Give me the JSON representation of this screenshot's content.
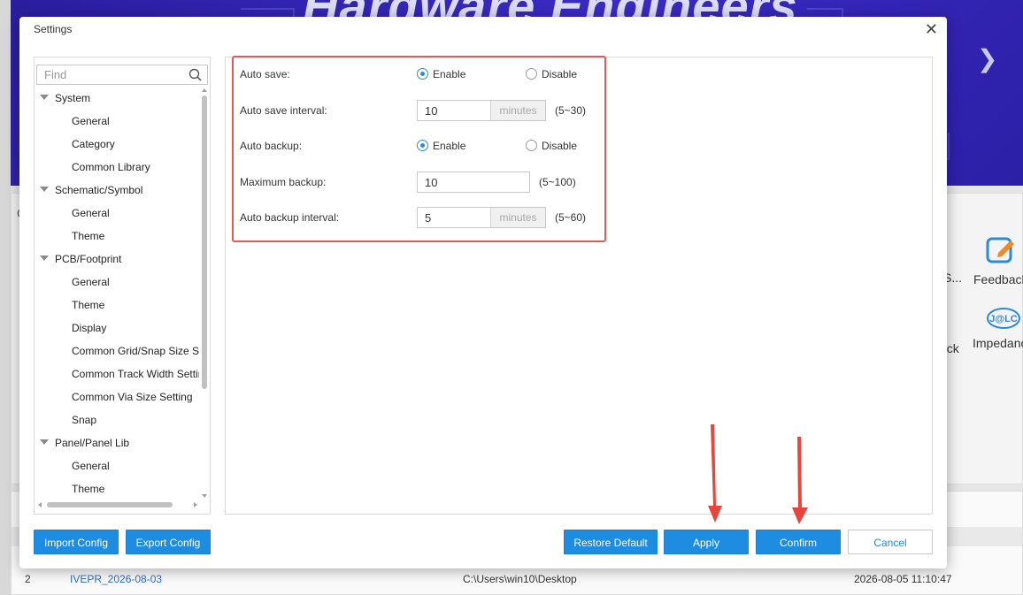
{
  "background": {
    "banner_title": "Hardware Engineers",
    "tools": [
      {
        "label": "S...",
        "icon": "tool-icon"
      },
      {
        "label": "Feedback",
        "icon": "feedback-icon"
      },
      {
        "label": "ack",
        "icon": "stack-icon"
      },
      {
        "label": "Impedance",
        "icon": "jlc-impedance-icon"
      }
    ],
    "edge_letter": "C",
    "list_row_count": "8",
    "recent_row": {
      "index": "2",
      "name": "IVEPR_2026-08-03",
      "path": "C:\\Users\\win10\\Desktop",
      "time": "2026-08-05 11:10:47"
    }
  },
  "dialog": {
    "title": "Settings",
    "find_placeholder": "Find",
    "tree": [
      {
        "label": "System",
        "type": "category"
      },
      {
        "label": "General",
        "type": "leaf"
      },
      {
        "label": "Category",
        "type": "leaf"
      },
      {
        "label": "Common Library",
        "type": "leaf"
      },
      {
        "label": "Schematic/Symbol",
        "type": "category"
      },
      {
        "label": "General",
        "type": "leaf"
      },
      {
        "label": "Theme",
        "type": "leaf"
      },
      {
        "label": "PCB/Footprint",
        "type": "category"
      },
      {
        "label": "General",
        "type": "leaf"
      },
      {
        "label": "Theme",
        "type": "leaf"
      },
      {
        "label": "Display",
        "type": "leaf"
      },
      {
        "label": "Common Grid/Snap Size Se",
        "type": "leaf"
      },
      {
        "label": "Common Track Width Settir",
        "type": "leaf"
      },
      {
        "label": "Common Via Size Setting",
        "type": "leaf"
      },
      {
        "label": "Snap",
        "type": "leaf"
      },
      {
        "label": "Panel/Panel Lib",
        "type": "category"
      },
      {
        "label": "General",
        "type": "leaf"
      },
      {
        "label": "Theme",
        "type": "leaf"
      }
    ],
    "settings": {
      "auto_save": {
        "label": "Auto save:",
        "enable": "Enable",
        "disable": "Disable",
        "selected": "Enable"
      },
      "auto_save_interval": {
        "label": "Auto save interval:",
        "value": "10",
        "unit": "minutes",
        "range": "(5~30)"
      },
      "auto_backup": {
        "label": "Auto backup:",
        "enable": "Enable",
        "disable": "Disable",
        "selected": "Enable"
      },
      "maximum_backup": {
        "label": "Maximum backup:",
        "value": "10",
        "range": "(5~100)"
      },
      "auto_backup_interval": {
        "label": "Auto backup interval:",
        "value": "5",
        "unit": "minutes",
        "range": "(5~60)"
      }
    },
    "buttons": {
      "import_config": "Import Config",
      "export_config": "Export Config",
      "restore_default": "Restore Default",
      "apply": "Apply",
      "confirm": "Confirm",
      "cancel": "Cancel"
    },
    "colors": {
      "primary": "#1e8ce0",
      "highlight": "#e05a5a",
      "annotation_arrow": "#e8453c"
    }
  }
}
